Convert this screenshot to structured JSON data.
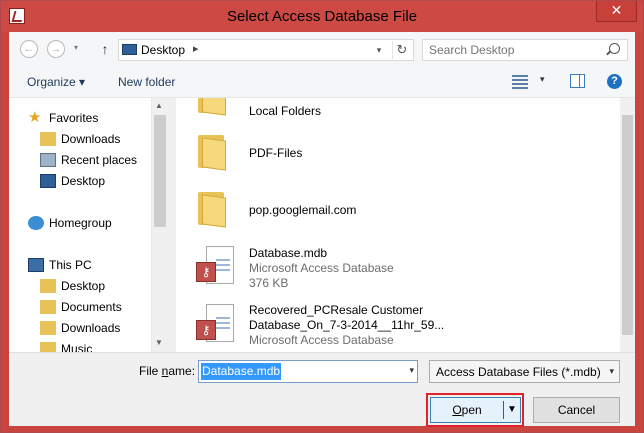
{
  "window": {
    "title": "Select Access Database File",
    "close_label": "✕"
  },
  "address": {
    "location": "Desktop",
    "separator": "▸"
  },
  "search": {
    "placeholder": "Search Desktop"
  },
  "toolbar": {
    "organize_label": "Organize ▾",
    "new_folder_label": "New folder",
    "view_dropdown": "▾",
    "help_label": "?"
  },
  "nav": {
    "favorites": "Favorites",
    "fav_items": [
      "Downloads",
      "Recent places",
      "Desktop"
    ],
    "homegroup": "Homegroup",
    "thispc": "This PC",
    "pc_items": [
      "Desktop",
      "Documents",
      "Downloads",
      "Music"
    ]
  },
  "files": [
    {
      "name": "Local Folders",
      "type": "folder"
    },
    {
      "name": "PDF-Files",
      "type": "folder"
    },
    {
      "name": "pop.googlemail.com",
      "type": "folder"
    },
    {
      "name": "Database.mdb",
      "type": "access",
      "kind": "Microsoft Access Database",
      "size": "376 KB"
    },
    {
      "name_line1": "Recovered_PCResale Customer",
      "name_line2": "Database_On_7-3-2014__11hr_59...",
      "type": "access",
      "kind": "Microsoft Access Database"
    }
  ],
  "bottom": {
    "filename_label_prefix": "File ",
    "filename_label_underline": "n",
    "filename_label_suffix": "ame:",
    "filename_value": "Database.mdb",
    "filetype_value": "Access Database Files (*.mdb)",
    "open_underline": "O",
    "open_rest": "pen",
    "cancel_label": "Cancel"
  },
  "colors": {
    "title_bar": "#cc4a43",
    "selection": "#3399ff",
    "highlight_border": "#e2222a"
  }
}
